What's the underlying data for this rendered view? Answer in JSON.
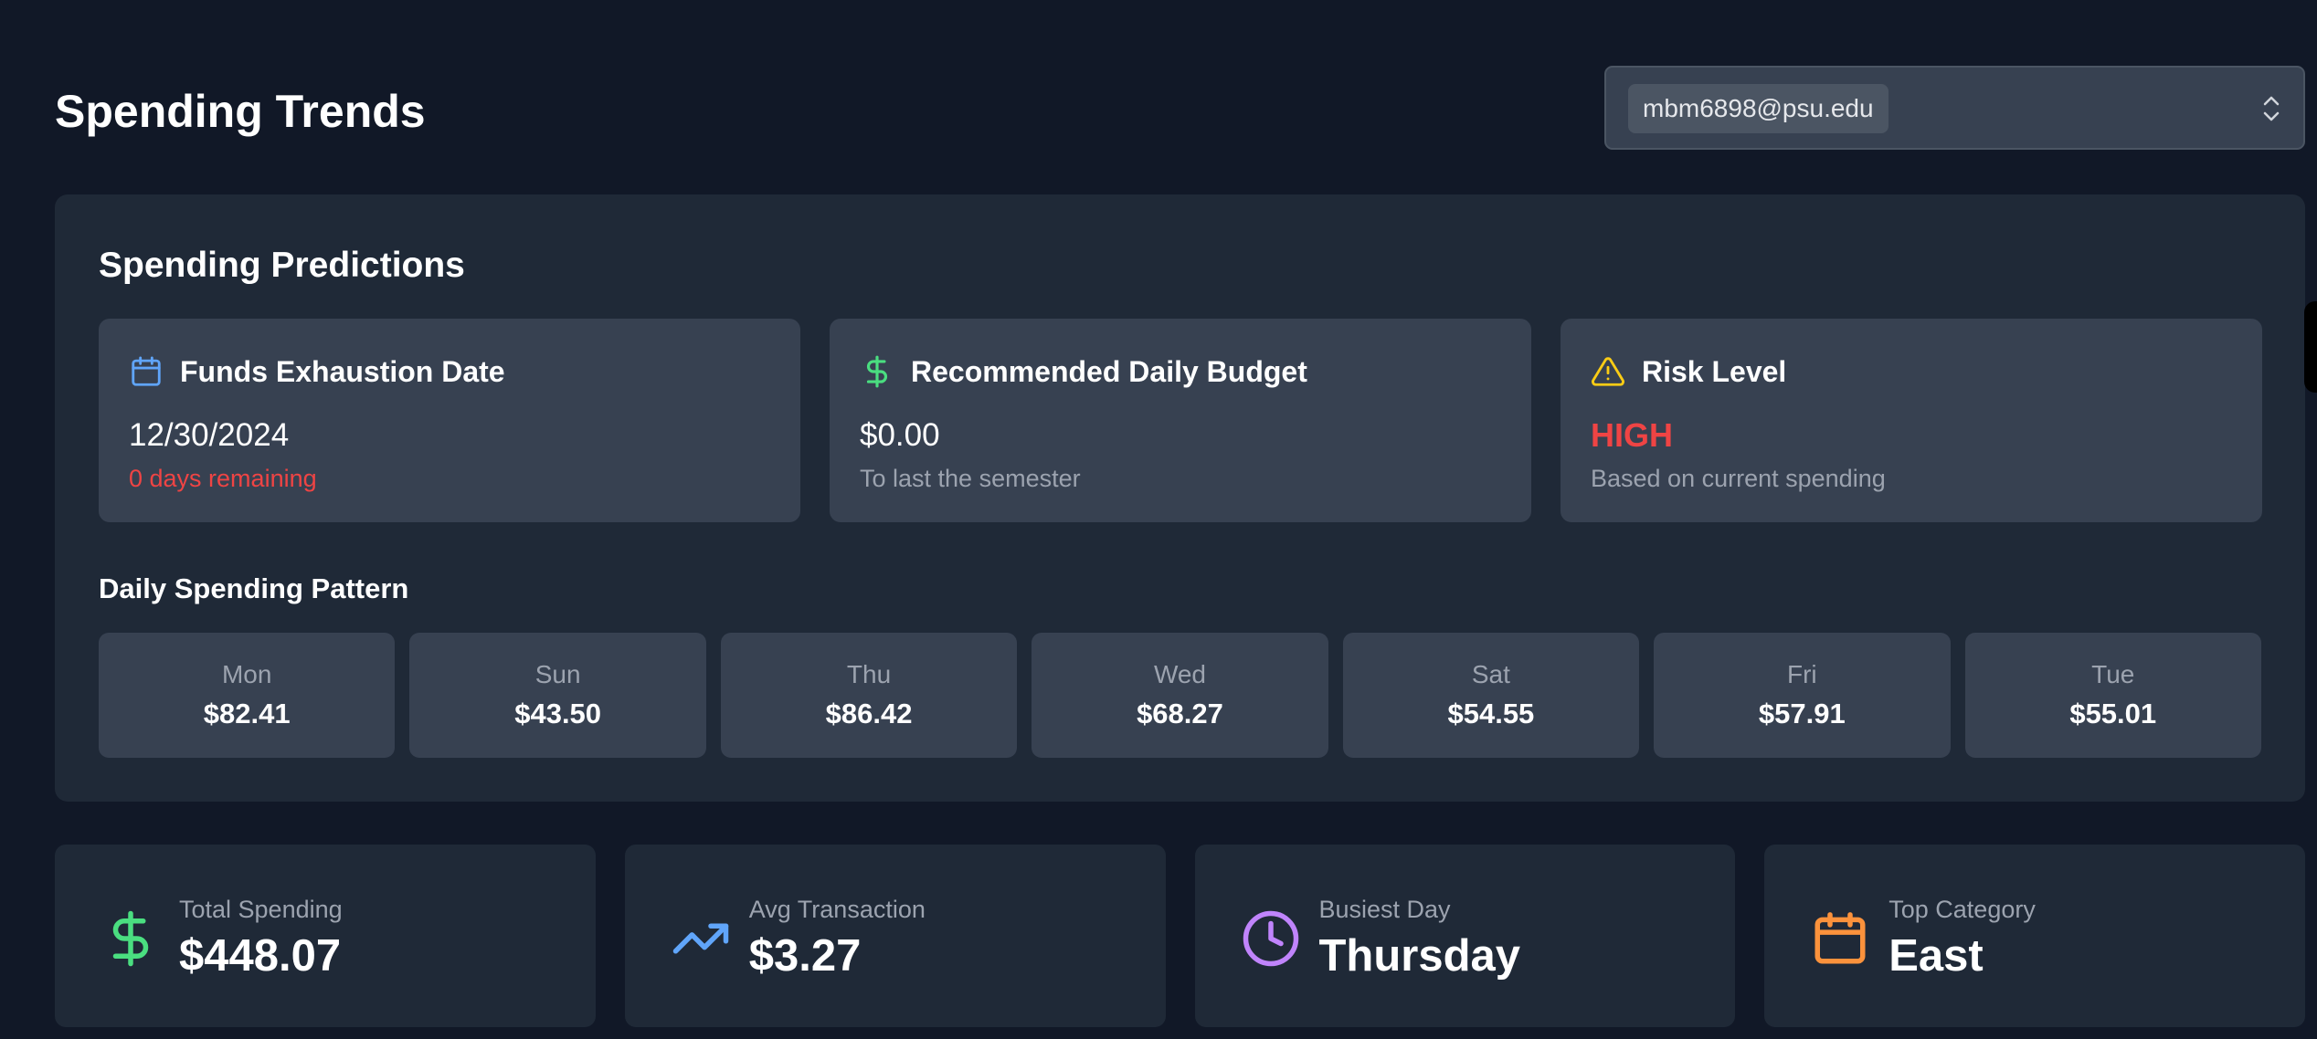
{
  "header": {
    "title": "Spending Trends",
    "user_select": {
      "value": "mbm6898@psu.edu"
    }
  },
  "predictions": {
    "title": "Spending Predictions",
    "cards": [
      {
        "icon": "calendar-icon",
        "title": "Funds Exhaustion Date",
        "value": "12/30/2024",
        "subtitle": "0 days remaining"
      },
      {
        "icon": "dollar-icon",
        "title": "Recommended Daily Budget",
        "value": "$0.00",
        "subtitle": "To last the semester"
      },
      {
        "icon": "warning-icon",
        "title": "Risk Level",
        "value": "HIGH",
        "subtitle": "Based on current spending"
      }
    ],
    "pattern": {
      "title": "Daily Spending Pattern",
      "days": [
        {
          "day": "Mon",
          "amount": "$82.41"
        },
        {
          "day": "Sun",
          "amount": "$43.50"
        },
        {
          "day": "Thu",
          "amount": "$86.42"
        },
        {
          "day": "Wed",
          "amount": "$68.27"
        },
        {
          "day": "Sat",
          "amount": "$54.55"
        },
        {
          "day": "Fri",
          "amount": "$57.91"
        },
        {
          "day": "Tue",
          "amount": "$55.01"
        }
      ]
    }
  },
  "stats": [
    {
      "icon": "dollar-icon",
      "label": "Total Spending",
      "value": "$448.07"
    },
    {
      "icon": "trending-up-icon",
      "label": "Avg Transaction",
      "value": "$3.27"
    },
    {
      "icon": "clock-icon",
      "label": "Busiest Day",
      "value": "Thursday"
    },
    {
      "icon": "calendar-icon",
      "label": "Top Category",
      "value": "East"
    }
  ],
  "colors": {
    "background": "#111827",
    "panel": "#1f2937",
    "card": "#374151",
    "danger": "#ef4444",
    "green": "#4ade80",
    "blue": "#60a5fa",
    "yellow": "#facc15",
    "purple": "#c084fc",
    "orange": "#fb923c"
  }
}
